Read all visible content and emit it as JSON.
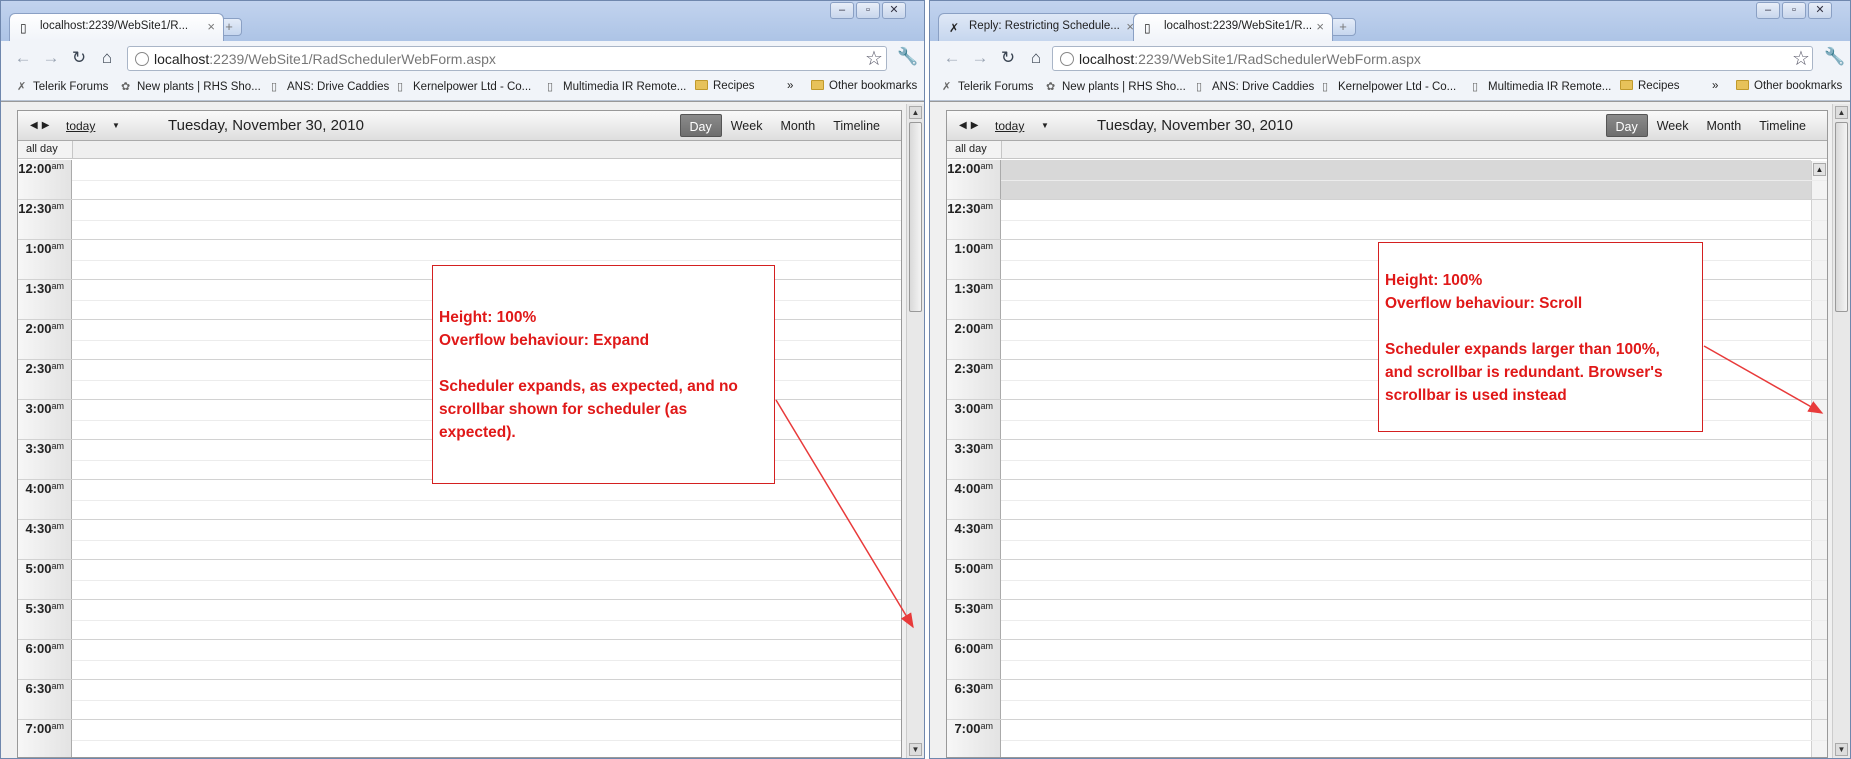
{
  "left": {
    "tabs": [
      {
        "title": "localhost:2239/WebSite1/R...",
        "close": "×",
        "active": true
      }
    ],
    "new_tab": "+",
    "address": {
      "host": "localhost",
      "rest": ":2239/WebSite1/RadSchedulerWebForm.aspx"
    },
    "bookmarks": [
      {
        "label": "Telerik Forums",
        "icon": "telerik-icon"
      },
      {
        "label": "New plants | RHS Sho...",
        "icon": "plant-icon"
      },
      {
        "label": "ANS: Drive Caddies",
        "icon": "page-icon"
      },
      {
        "label": "Kernelpower Ltd - Co...",
        "icon": "page-icon"
      },
      {
        "label": "Multimedia IR Remote...",
        "icon": "page-icon"
      },
      {
        "label": "Recipes",
        "icon": "folder-icon"
      }
    ],
    "bookmarks_more": "»",
    "other_bookmarks": "Other bookmarks",
    "note": {
      "line1": "Height: 100%",
      "line2": "Overflow behaviour: Expand",
      "line3": "Scheduler expands, as expected, and no",
      "line4": "scrollbar shown for scheduler (as",
      "line5": "expected)."
    }
  },
  "right": {
    "tabs": [
      {
        "title": "Reply: Restricting Schedule...",
        "close": "×",
        "active": false
      },
      {
        "title": "localhost:2239/WebSite1/R...",
        "close": "×",
        "active": true
      }
    ],
    "new_tab": "+",
    "address": {
      "host": "localhost",
      "rest": ":2239/WebSite1/RadSchedulerWebForm.aspx"
    },
    "bookmarks": [
      {
        "label": "Telerik Forums",
        "icon": "telerik-icon"
      },
      {
        "label": "New plants | RHS Sho...",
        "icon": "plant-icon"
      },
      {
        "label": "ANS: Drive Caddies",
        "icon": "page-icon"
      },
      {
        "label": "Kernelpower Ltd - Co...",
        "icon": "page-icon"
      },
      {
        "label": "Multimedia IR Remote...",
        "icon": "page-icon"
      },
      {
        "label": "Recipes",
        "icon": "folder-icon"
      }
    ],
    "bookmarks_more": "»",
    "other_bookmarks": "Other bookmarks",
    "note": {
      "line1": "Height: 100%",
      "line2": "Overflow behaviour: Scroll",
      "line3": "Scheduler expands larger than 100%,",
      "line4": "and scrollbar is redundant.  Browser's",
      "line5": "scrollbar is used instead"
    }
  },
  "scheduler": {
    "today_label": "today",
    "date": "Tuesday, November 30, 2010",
    "views": [
      "Day",
      "Week",
      "Month",
      "Timeline"
    ],
    "selected_view": "Day",
    "all_day_label": "all day",
    "times": [
      "12:00",
      "12:30",
      "1:00",
      "1:30",
      "2:00",
      "2:30",
      "3:00",
      "3:30",
      "4:00",
      "4:30",
      "5:00",
      "5:30",
      "6:00",
      "6:30",
      "7:00"
    ],
    "ampm": "am"
  },
  "colors": {
    "annotation": "#e01818",
    "selected_view": "#777777",
    "chrome": "#cfdcef"
  }
}
